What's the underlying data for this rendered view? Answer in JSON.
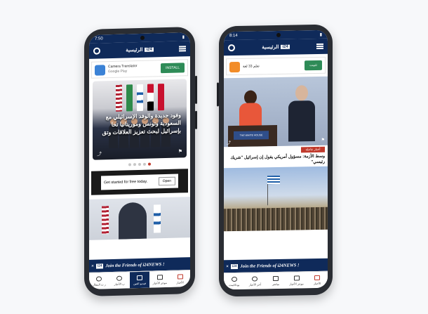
{
  "left_phone": {
    "status_time": "7:50",
    "app_title": "الرئيسية",
    "logo_text": "i24",
    "ad_top": {
      "title": "Camera Translator",
      "subtitle": "Google Play",
      "button": "INSTALL"
    },
    "hero_caption": "وفود جديدة والوفد الإسرائيلي مع السعودية وتونس وموريتانيا تحا بإسرائيل لبحث تعزيز العلاقات وتق",
    "ad_mid": {
      "text": "Get started for free today.",
      "button": "Open"
    },
    "banner_text": "Join the Friends of i24NEWS !",
    "banner_close": "×",
    "banner_badge": "i24",
    "tabs": [
      {
        "label": "ر ث المقال"
      },
      {
        "label": "ب الأخبار"
      },
      {
        "label": "فيديو العين"
      },
      {
        "label": "موجز الأخبار"
      },
      {
        "label": "الأخبار"
      }
    ]
  },
  "right_phone": {
    "status_time": "8:14",
    "app_title": "الرئيسية",
    "logo_text": "i24",
    "ad_top": {
      "title": "تعلم 33 لغة",
      "subtitle": "",
      "button": "تثبيت"
    },
    "podium_sign": "THE WHITE HOUSE",
    "news_tag": "أخبار عاجلة",
    "headline": "وسط الأزمة: مسؤول أمريكي يقول إن إسرائيل \"شريك رئيسي\"",
    "banner_text": "Join the Friends of i24NEWS !",
    "banner_close": "×",
    "banner_badge": "i24",
    "tabs": [
      {
        "label": "بودكاست"
      },
      {
        "label": "آخر الأخبار"
      },
      {
        "label": "مباشر"
      },
      {
        "label": "موجز الأخبار"
      },
      {
        "label": "الأخبار"
      }
    ]
  },
  "colors": {
    "brand_navy": "#0f2a5a",
    "accent_red": "#c0392b",
    "install_green": "#2e8b57"
  }
}
